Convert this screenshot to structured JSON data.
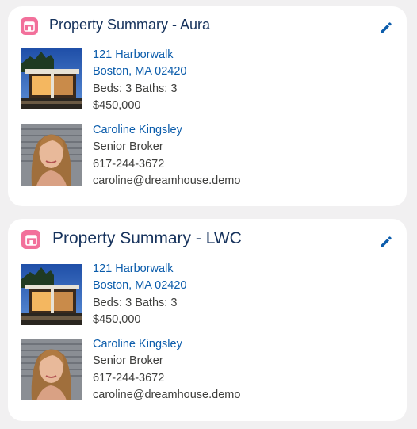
{
  "cards": [
    {
      "title": "Property Summary - Aura",
      "icon": "property-icon",
      "edit_icon": "pencil-icon",
      "property": {
        "address_line1": "121 Harborwalk",
        "address_line2": "Boston, MA 02420",
        "beds_baths": "Beds: 3 Baths: 3",
        "price": "$450,000"
      },
      "broker": {
        "name": "Caroline Kingsley",
        "title": "Senior Broker",
        "phone": "617-244-3672",
        "email": "caroline@dreamhouse.demo"
      }
    },
    {
      "title": "Property Summary - LWC",
      "icon": "property-icon",
      "edit_icon": "pencil-icon",
      "property": {
        "address_line1": "121 Harborwalk",
        "address_line2": "Boston, MA 02420",
        "beds_baths": "Beds: 3 Baths: 3",
        "price": "$450,000"
      },
      "broker": {
        "name": "Caroline Kingsley",
        "title": "Senior Broker",
        "phone": "617-244-3672",
        "email": "caroline@dreamhouse.demo"
      }
    }
  ],
  "colors": {
    "background": "#f1f0f1",
    "card": "#ffffff",
    "title": "#16325c",
    "link": "#0b5cab",
    "icon_bg": "#f2709b"
  }
}
